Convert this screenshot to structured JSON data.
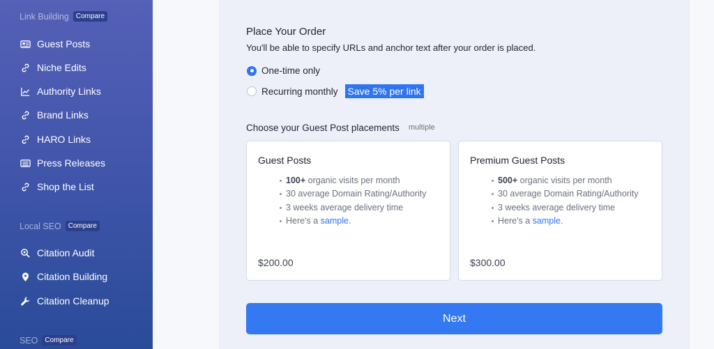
{
  "sidebar": {
    "sections": [
      {
        "title": "Link Building",
        "compare": "Compare",
        "items": [
          {
            "label": "Guest Posts",
            "icon": "newspaper-icon"
          },
          {
            "label": "Niche Edits",
            "icon": "link-icon"
          },
          {
            "label": "Authority Links",
            "icon": "chart-line-icon"
          },
          {
            "label": "Brand Links",
            "icon": "link-icon"
          },
          {
            "label": "HARO Links",
            "icon": "link-icon"
          },
          {
            "label": "Press Releases",
            "icon": "newspaper-icon"
          },
          {
            "label": "Shop the List",
            "icon": "link-icon"
          }
        ]
      },
      {
        "title": "Local SEO",
        "compare": "Compare",
        "items": [
          {
            "label": "Citation Audit",
            "icon": "search-icon"
          },
          {
            "label": "Citation Building",
            "icon": "map-pin-icon"
          },
          {
            "label": "Citation Cleanup",
            "icon": "wrench-icon"
          }
        ]
      },
      {
        "title": "SEO",
        "compare": "Compare",
        "items": []
      }
    ]
  },
  "order": {
    "title": "Place Your Order",
    "subtitle": "You'll be able to specify URLs and anchor text after your order is placed.",
    "options": [
      {
        "label": "One-time only",
        "checked": true
      },
      {
        "label": "Recurring monthly",
        "checked": false,
        "badge": "Save 5% per link"
      }
    ]
  },
  "placements": {
    "title": "Choose your Guest Post placements",
    "badge": "multiple",
    "cards": [
      {
        "title": "Guest Posts",
        "features": [
          {
            "bold": "100+",
            "text": " organic visits per month"
          },
          {
            "text": "30 average Domain Rating/Authority"
          },
          {
            "text": "3 weeks average delivery time"
          },
          {
            "text": "Here's a ",
            "link": "sample",
            "after": "."
          }
        ],
        "price": "$200.00"
      },
      {
        "title": "Premium Guest Posts",
        "features": [
          {
            "bold": "500+",
            "text": " organic visits per month"
          },
          {
            "text": "30 average Domain Rating/Authority"
          },
          {
            "text": "3 weeks average delivery time"
          },
          {
            "text": "Here's a ",
            "link": "sample",
            "after": "."
          }
        ],
        "price": "$300.00"
      }
    ]
  },
  "next_label": "Next",
  "colors": {
    "accent": "#2f74f0",
    "sidebar_top": "#5560b7",
    "sidebar_bottom": "#2a4b99"
  }
}
